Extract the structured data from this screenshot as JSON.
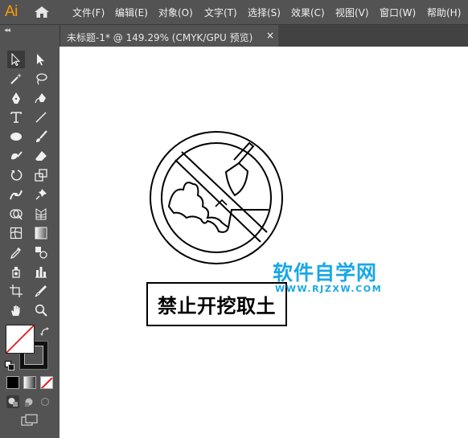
{
  "app": {
    "logo": "Ai"
  },
  "menu": [
    "文件(F)",
    "编辑(E)",
    "对象(O)",
    "文字(T)",
    "选择(S)",
    "效果(C)",
    "视图(V)",
    "窗口(W)",
    "帮助(H)"
  ],
  "document_tab": {
    "title": "未标题-1* @ 149.29% (CMYK/GPU 预览)",
    "close": "×"
  },
  "toolbar": {
    "collapse": "◂◂"
  },
  "canvas": {
    "sign_label": "禁止开挖取土",
    "watermark_title": "软件自学网",
    "watermark_url": "WWW.RJZXW.COM"
  },
  "colors": {
    "accent": "#ff9a00",
    "watermark": "#18a8e6"
  },
  "icons": [
    "selection-tool-icon",
    "direct-selection-tool-icon",
    "magic-wand-tool-icon",
    "lasso-tool-icon",
    "pen-tool-icon",
    "curvature-tool-icon",
    "type-tool-icon",
    "line-segment-tool-icon",
    "ellipse-tool-icon",
    "paintbrush-tool-icon",
    "blob-brush-tool-icon",
    "eraser-tool-icon",
    "rotate-tool-icon",
    "scale-tool-icon",
    "puppet-warp-tool-icon",
    "pin-tool-icon",
    "shape-builder-tool-icon",
    "perspective-grid-tool-icon",
    "mesh-tool-icon",
    "gradient-tool-icon",
    "eyedropper-tool-icon",
    "blend-tool-icon",
    "symbol-sprayer-tool-icon",
    "column-graph-tool-icon",
    "artboard-tool-icon",
    "slice-tool-icon",
    "hand-tool-icon",
    "zoom-tool-icon"
  ]
}
